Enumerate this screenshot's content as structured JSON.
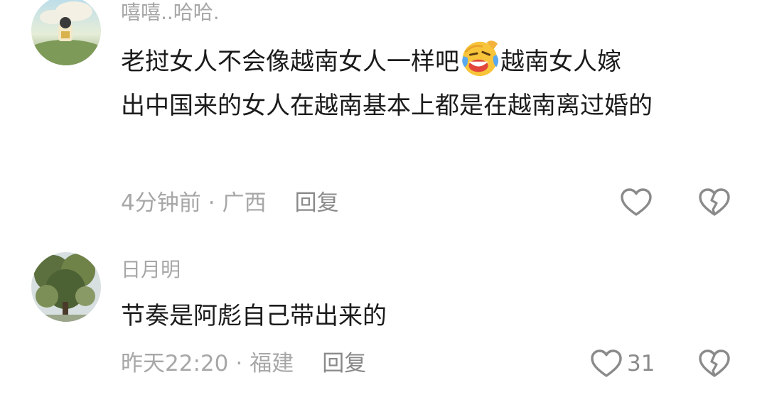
{
  "comments": [
    {
      "username": "嘻嘻..哈哈.",
      "text_line1": "老挝女人不会像越南女人一样吧",
      "emoji": "face-with-tears-of-joy",
      "text_line1_end": "越南女人嫁",
      "text_rest": "出中国来的女人在越南基本上都是在越南离过婚的",
      "time": "4分钟前",
      "separator": "·",
      "location": "广西",
      "reply_label": "回复",
      "likes": ""
    },
    {
      "username": "日月明",
      "text": "节奏是阿彪自己带出来的",
      "time": "昨天22:20",
      "separator": "·",
      "location": "福建",
      "reply_label": "回复",
      "likes": "31"
    }
  ],
  "colors": {
    "username": "#a7a7a7",
    "text": "#1b1b1b",
    "meta": "#a7a7a7",
    "icon": "#8a8a8a"
  }
}
